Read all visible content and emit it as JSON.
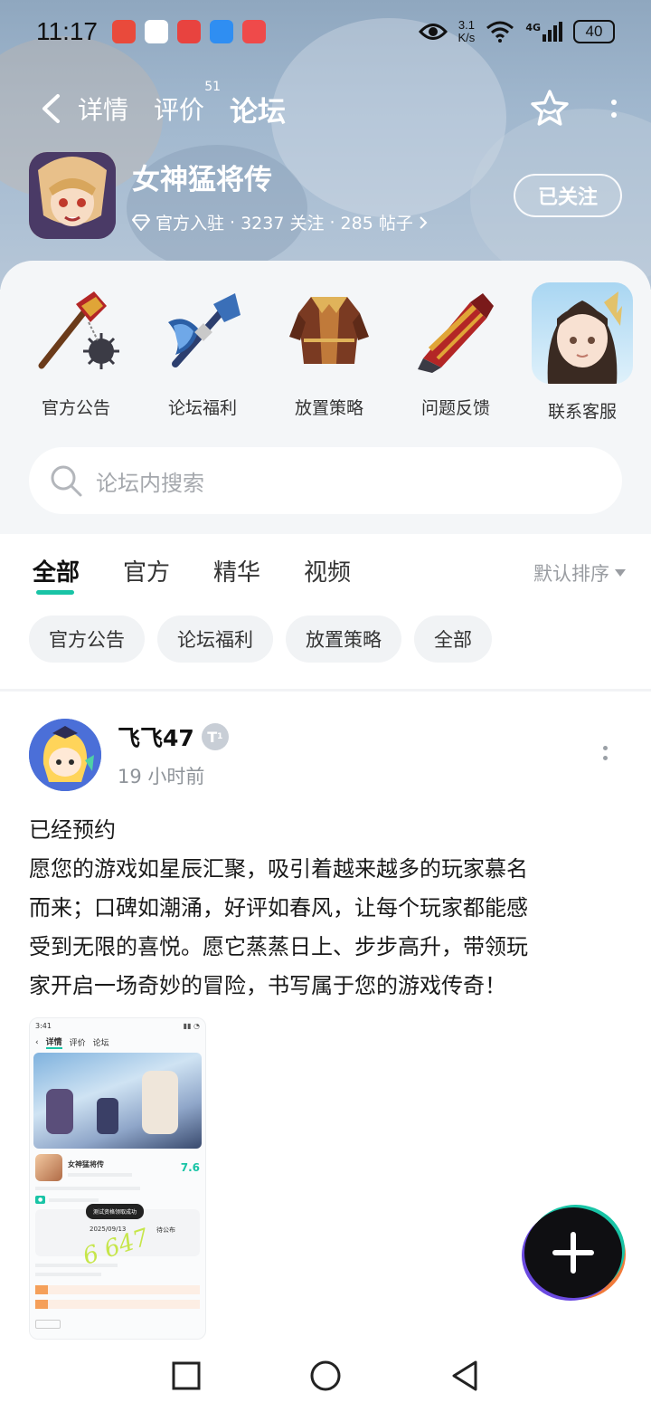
{
  "status_bar": {
    "time": "11:17",
    "net_speed_value": "3.1",
    "net_speed_unit": "K/s",
    "network": "4G",
    "battery": "40",
    "app_icon_colors": [
      "#e94a3b",
      "#ffffff",
      "#e8433f",
      "#2f8ef2",
      "#ef4a4a"
    ]
  },
  "nav": {
    "back_icon": "chevron-left-icon",
    "tabs": [
      {
        "label": "详情"
      },
      {
        "label": "评价",
        "badge": "51"
      },
      {
        "label": "论坛"
      }
    ],
    "active_tab": "论坛",
    "star_icon": "star-smile-icon",
    "more_icon": "more-vertical-icon"
  },
  "game": {
    "name": "女神猛将传",
    "verified_label": "官方入驻",
    "followers": "3237 关注",
    "posts": "285 帖子",
    "separator": "·",
    "follow_button": "已关注"
  },
  "shortcuts": [
    {
      "label": "官方公告",
      "icon": "spiked-mace-icon"
    },
    {
      "label": "论坛福利",
      "icon": "blue-axe-icon"
    },
    {
      "label": "放置策略",
      "icon": "armor-robe-icon"
    },
    {
      "label": "问题反馈",
      "icon": "red-gauntlet-icon"
    },
    {
      "label": "联系客服",
      "icon": "anime-girl-avatar-icon"
    }
  ],
  "search": {
    "placeholder": "论坛内搜索"
  },
  "filter_tabs": [
    {
      "label": "全部"
    },
    {
      "label": "官方"
    },
    {
      "label": "精华"
    },
    {
      "label": "视频"
    }
  ],
  "active_filter": "全部",
  "sort_label": "默认排序",
  "chips": [
    {
      "label": "官方公告"
    },
    {
      "label": "论坛福利"
    },
    {
      "label": "放置策略"
    },
    {
      "label": "全部"
    }
  ],
  "post": {
    "author": "飞飞47",
    "level_badge": "T",
    "level_sub": "1",
    "time": "19 小时前",
    "lines": [
      "已经预约",
      "愿您的游戏如星辰汇聚，吸引着越来越多的玩家慕名",
      "而来；口碑如潮涌，好评如春风，让每个玩家都能感",
      "受到无限的喜悦。愿它蒸蒸日上、步步高升，带领玩",
      "家开启一场奇妙的冒险，书写属于您的游戏传奇！"
    ],
    "thumbnail": {
      "time": "3:41",
      "tabs": [
        "详情",
        "评价",
        "论坛"
      ],
      "game_name": "女神猛将传",
      "score": "7.6",
      "toast": "测试资格领取成功",
      "date": "2025/09/13",
      "pending": "待公布",
      "handwriting": "6 647"
    }
  },
  "fab": {
    "icon": "plus-icon"
  },
  "system_nav": [
    "square-icon",
    "circle-icon",
    "triangle-back-icon"
  ],
  "colors": {
    "accent": "#19c4a6",
    "text": "#222222",
    "muted": "#8f949a",
    "panel": "#f4f6f8"
  }
}
